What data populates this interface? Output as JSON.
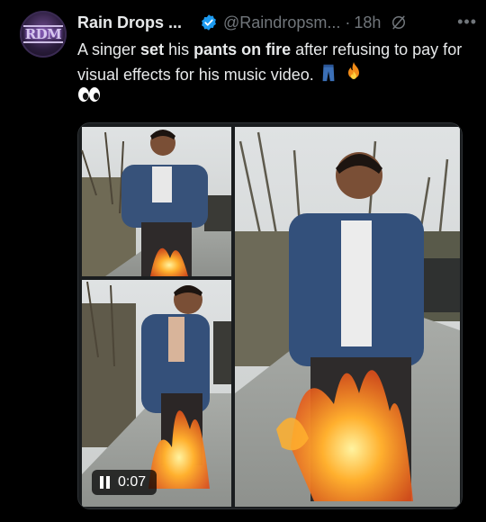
{
  "tweet": {
    "author_name": "Rain Drops ...",
    "handle": "@Raindropsm...",
    "separator": "·",
    "time": "18h",
    "avatar_text": "RDM",
    "text_parts": {
      "p1": "A singer ",
      "b1": "set",
      "p2": " his ",
      "b2": "pants on fire",
      "p3": " after refusing to pay for visual effects for his music video. "
    },
    "emojis": [
      "jeans-icon",
      "fire-icon",
      "eyes-icon"
    ]
  },
  "video": {
    "timestamp": "0:07",
    "state": "playing"
  },
  "colors": {
    "background": "#000000",
    "text": "#e7e9ea",
    "muted": "#71767b",
    "verified": "#1d9bf0"
  }
}
